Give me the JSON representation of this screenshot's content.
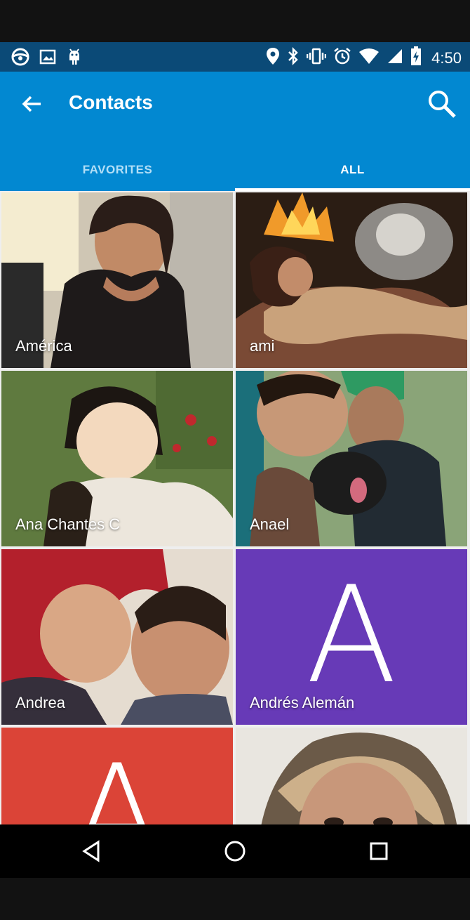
{
  "status_bar": {
    "time": "4:50",
    "left_icons": [
      "steering-wheel-icon",
      "image-icon",
      "android-icon"
    ],
    "right_icons": [
      "location-icon",
      "bluetooth-icon",
      "vibrate-icon",
      "alarm-icon",
      "wifi-icon",
      "signal-icon",
      "battery-charging-icon"
    ]
  },
  "app_bar": {
    "title": "Contacts",
    "background": "#0288d1"
  },
  "tabs": [
    {
      "label": "FAVORITES",
      "selected": false
    },
    {
      "label": "ALL",
      "selected": true
    }
  ],
  "contacts": [
    {
      "name": "América",
      "type": "photo"
    },
    {
      "name": "ami",
      "type": "photo"
    },
    {
      "name": "Ana Chantes C",
      "type": "photo"
    },
    {
      "name": "Anael",
      "type": "photo"
    },
    {
      "name": "Andrea",
      "type": "photo"
    },
    {
      "name": "Andrés Alemán",
      "type": "letter",
      "letter": "A",
      "color": "#673ab7"
    },
    {
      "name": "",
      "type": "letter",
      "letter": "A",
      "color": "#db4437"
    },
    {
      "name": "",
      "type": "photo"
    }
  ],
  "nav_bar": [
    "back-icon",
    "home-icon",
    "recents-icon"
  ]
}
